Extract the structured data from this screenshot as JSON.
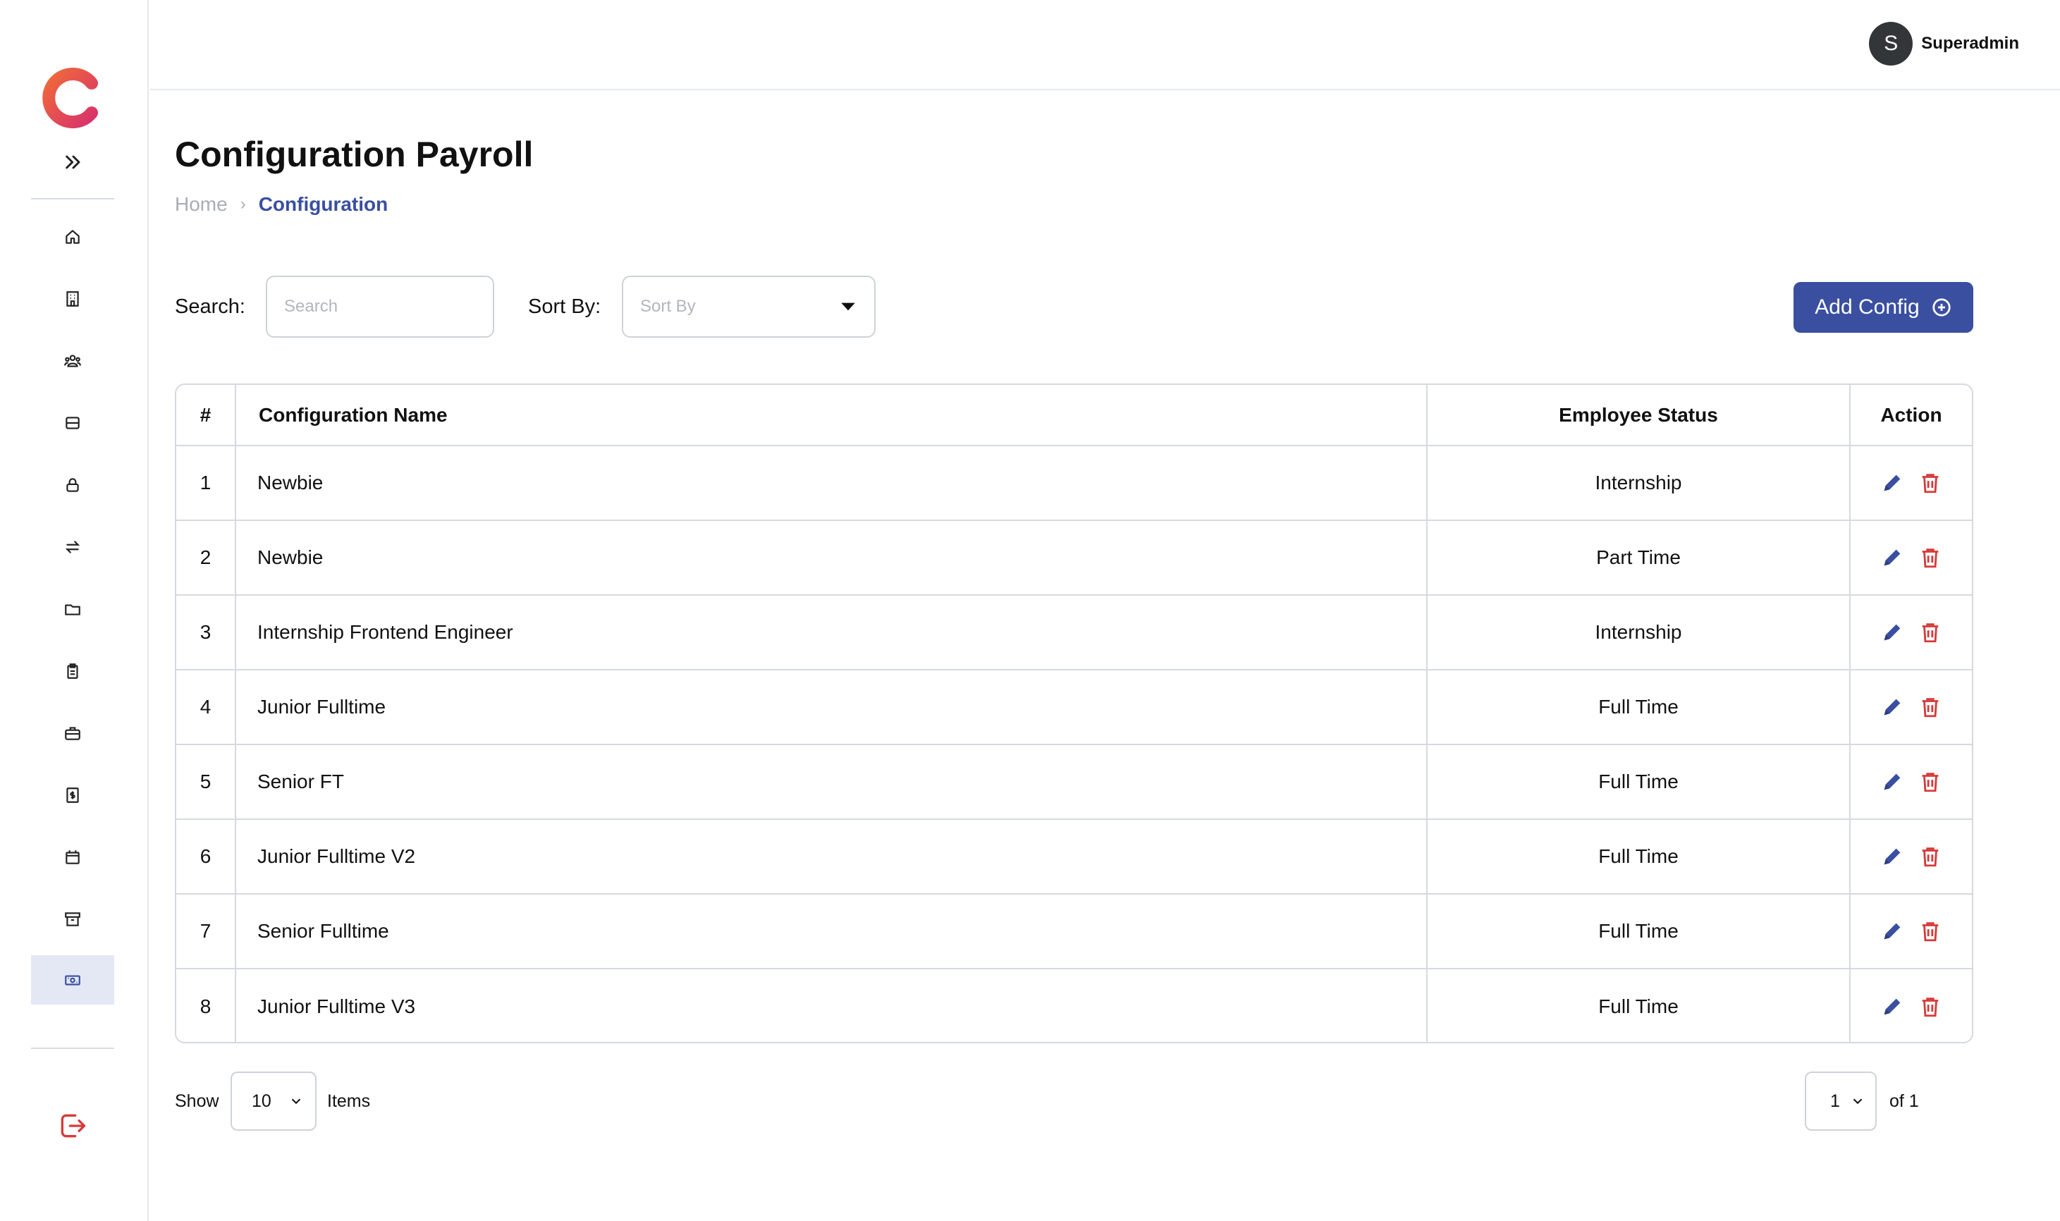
{
  "header": {
    "user_initial": "S",
    "user_name": "Superadmin"
  },
  "page": {
    "title": "Configuration Payroll",
    "breadcrumb": {
      "home": "Home",
      "separator": "›",
      "current": "Configuration"
    }
  },
  "toolbar": {
    "search_label": "Search:",
    "search_placeholder": "Search",
    "search_value": "",
    "sort_label": "Sort By:",
    "sort_placeholder": "Sort By",
    "add_button_label": "Add Config"
  },
  "table": {
    "headers": {
      "num": "#",
      "name": "Configuration Name",
      "status": "Employee Status",
      "action": "Action"
    },
    "rows": [
      {
        "num": "1",
        "name": "Newbie",
        "status": "Internship"
      },
      {
        "num": "2",
        "name": "Newbie",
        "status": "Part Time"
      },
      {
        "num": "3",
        "name": "Internship Frontend Engineer",
        "status": "Internship"
      },
      {
        "num": "4",
        "name": "Junior Fulltime",
        "status": "Full Time"
      },
      {
        "num": "5",
        "name": "Senior FT",
        "status": "Full Time"
      },
      {
        "num": "6",
        "name": "Junior Fulltime V2",
        "status": "Full Time"
      },
      {
        "num": "7",
        "name": "Senior Fulltime",
        "status": "Full Time"
      },
      {
        "num": "8",
        "name": "Junior Fulltime V3",
        "status": "Full Time"
      }
    ]
  },
  "pagination": {
    "show_label": "Show",
    "page_size": "10",
    "items_label": "Items",
    "current_page": "1",
    "of_label": "of 1"
  },
  "colors": {
    "primary": "#3a4fa0",
    "danger": "#d63a3a",
    "sidebar_active_bg": "#e4e8f5"
  },
  "sidebar": {
    "icons": [
      "home-icon",
      "building-icon",
      "users-icon",
      "server-icon",
      "lock-icon",
      "transfer-icon",
      "folder-icon",
      "clipboard-icon",
      "briefcase-icon",
      "dollar-file-icon",
      "calendar-icon",
      "archive-icon",
      "payroll-money-icon"
    ],
    "active_icon": "payroll-money-icon"
  }
}
